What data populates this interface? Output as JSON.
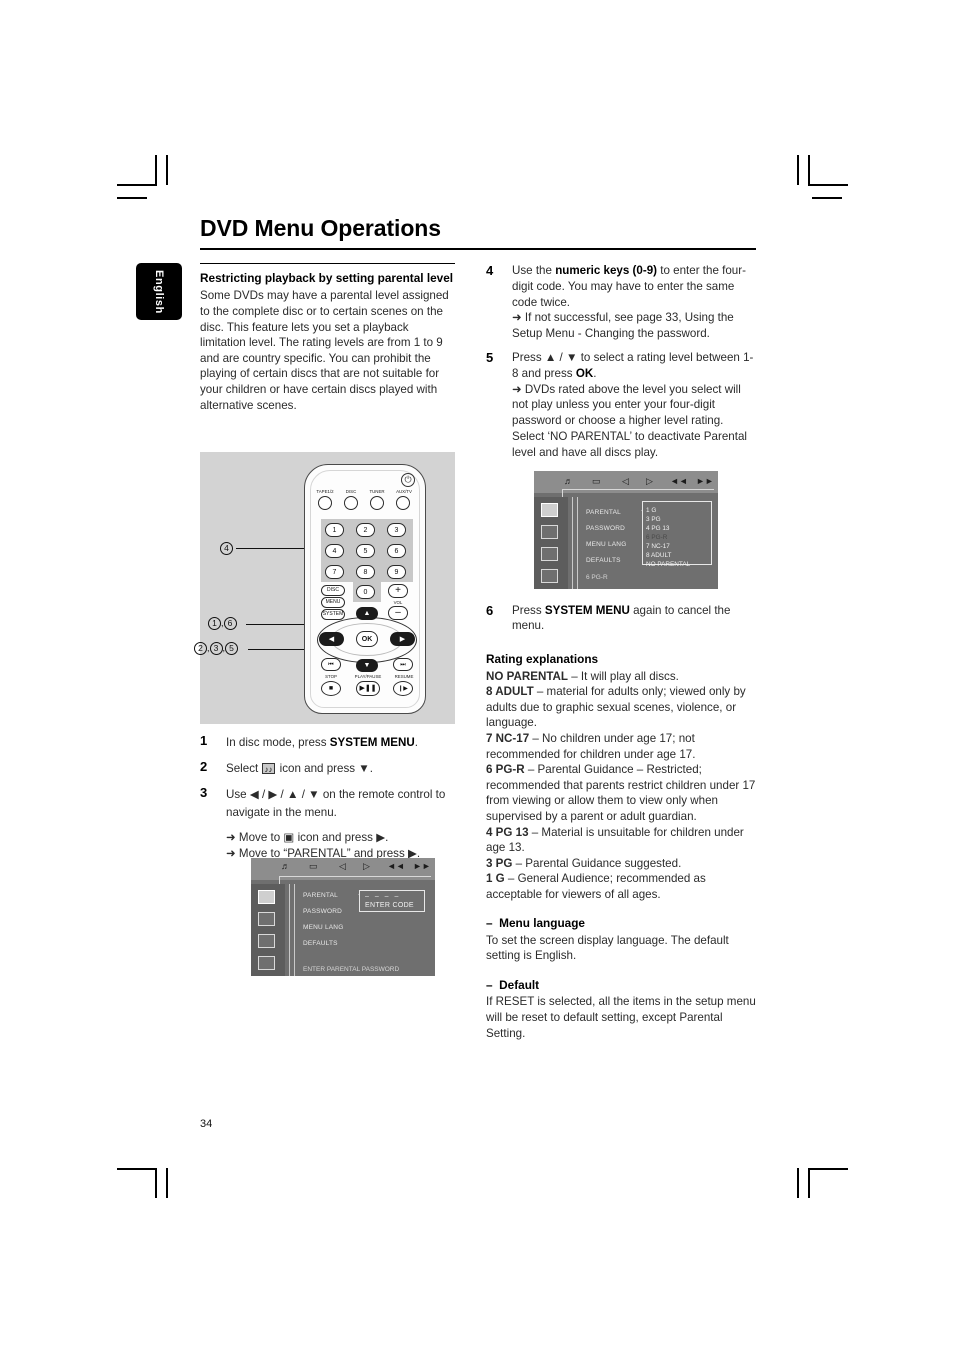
{
  "page": {
    "title": "DVD Menu Operations",
    "language_tab": "English",
    "page_number": "34"
  },
  "left_column": {
    "heading": "Restricting playback by setting parental level",
    "intro": "Some DVDs may have a parental level assigned to the complete disc or to certain scenes on the disc. This feature lets you set a playback limitation level. The rating levels are from 1 to 9 and are country specific. You can prohibit the playing of certain discs that are not suitable for your children or have certain discs played with alternative scenes.",
    "steps": [
      {
        "num": "1",
        "text_pre": "In disc mode, press ",
        "bold": "SYSTEM MENU",
        "text_post": "."
      },
      {
        "num": "2",
        "text_pre": "Select ",
        "icon": "sound-icon",
        "text_post": " icon and press ▼."
      },
      {
        "num": "3",
        "text_pre": "Use ◀ / ▶ / ▲ / ▼ on the remote control to navigate in the menu.",
        "sub": [
          "➜ Move to ▣ icon and press ▶.",
          "➜ Move to “PARENTAL” and press ▶."
        ]
      }
    ]
  },
  "right_column": {
    "steps": [
      {
        "num": "4",
        "text_pre": "Use the ",
        "bold": "numeric keys (0-9)",
        "text_post": " to enter the four-digit code. You may have to enter the same code twice.",
        "sub": [
          "➜ If not successful, see page  33, Using the Setup Menu - Changing the password."
        ]
      },
      {
        "num": "5",
        "text_pre": "Press ▲ / ▼ to select a rating level between 1-8 and press ",
        "bold": "OK",
        "text_post": ".",
        "sub": [
          "➜ DVDs rated above the level you select will not play unless you enter your four-digit password or choose a higher level rating. Select ‘NO PARENTAL’ to deactivate Parental level and have all discs play."
        ]
      },
      {
        "num": "6",
        "text_pre": "Press ",
        "bold": "SYSTEM MENU",
        "text_post": " again to cancel the menu."
      }
    ],
    "rating_heading": "Rating explanations",
    "ratings": [
      {
        "label": "NO PARENTAL",
        "desc": " – It will play all discs."
      },
      {
        "label": "8 ADULT",
        "desc": " – material for adults only; viewed only by adults due to graphic sexual scenes, violence, or language."
      },
      {
        "label": "7 NC-17",
        "desc": " – No children under age 17; not recommended for children under age 17."
      },
      {
        "label": "6 PG-R",
        "desc": " – Parental Guidance – Restricted; recommended that parents restrict children under 17 from viewing or allow them to view only when supervised by a parent or adult guardian."
      },
      {
        "label": "4 PG 13",
        "desc": " – Material is unsuitable for children under age 13."
      },
      {
        "label": "3 PG",
        "desc": " – Parental Guidance suggested."
      },
      {
        "label": "1 G",
        "desc": " – General Audience; recommended as acceptable for viewers of all ages."
      }
    ],
    "sections": [
      {
        "dash": "–",
        "heading": "Menu language",
        "body": "To set the screen display language. The default setting is English."
      },
      {
        "dash": "–",
        "heading": "Default",
        "body": "If RESET is selected, all the items in the setup menu will be reset to default setting, except Parental Setting."
      }
    ]
  },
  "remote": {
    "source_buttons": [
      "TAPE1/2",
      "DISC",
      "TUNER",
      "AUX/TV"
    ],
    "numeric_keys": [
      "1",
      "2",
      "3",
      "4",
      "5",
      "6",
      "7",
      "8",
      "9",
      "0"
    ],
    "function_buttons": [
      "DISC",
      "MENU",
      "SYSTEM"
    ],
    "volume_label": "VOL",
    "volume_plus": "+",
    "volume_minus": "–",
    "ok_label": "OK",
    "transport_labels": [
      "STOP",
      "PLAY/PAUSE",
      "RESUME"
    ],
    "power_icon": "power-icon",
    "callouts": [
      "4",
      "1 , 6",
      "2 , 3 , 5"
    ]
  },
  "osd_password": {
    "menu_items": [
      "PARENTAL",
      "PASSWORD",
      "MENU LANG",
      "DEFAULTS"
    ],
    "code_placeholder": "–  –  –  –",
    "code_caption": "ENTER CODE",
    "status": "ENTER PARENTAL PASSWORD",
    "topbar_icons": [
      "sound-icon",
      "picture-icon",
      "speaker-icon",
      "play-icon",
      "prev-icon",
      "next-icon"
    ],
    "sidebar_icons": [
      "picture-icon",
      "audio-icon",
      "subtitle-icon",
      "prefs-icon"
    ]
  },
  "osd_parental": {
    "menu_items": [
      "PARENTAL",
      "PASSWORD",
      "MENU LANG",
      "DEFAULTS"
    ],
    "rating_options": [
      "1 G",
      "3 PG",
      "4 PG 13",
      "6 PG-R",
      "7 NC-17",
      "8 ADULT",
      "NO PARENTAL"
    ],
    "selected_option": "6 PG-R",
    "status": "6 PG-R",
    "topbar_icons": [
      "sound-icon",
      "picture-icon",
      "speaker-icon",
      "play-icon",
      "prev-icon",
      "next-icon"
    ],
    "sidebar_icons": [
      "picture-icon",
      "audio-icon",
      "subtitle-icon",
      "prefs-icon"
    ]
  }
}
